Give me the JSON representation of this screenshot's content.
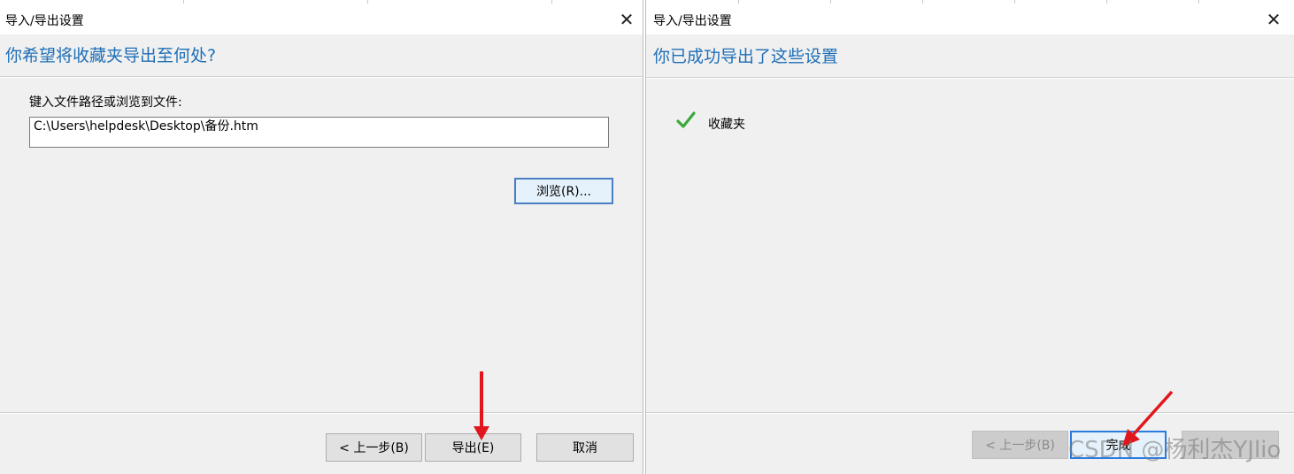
{
  "left_dialog": {
    "title": "导入/导出设置",
    "heading": "你希望将收藏夹导出至何处?",
    "path_label": "键入文件路径或浏览到文件:",
    "path_value": "C:\\Users\\helpdesk\\Desktop\\备份.htm",
    "browse_button": "浏览(R)...",
    "back_button": "< 上一步(B)",
    "export_button": "导出(E)",
    "cancel_button": "取消"
  },
  "right_dialog": {
    "title": "导入/导出设置",
    "heading": "你已成功导出了这些设置",
    "item_label": "收藏夹",
    "back_button": "< 上一步(B)",
    "finish_button": "完成"
  },
  "watermark": "CSDN @杨利杰YJlio",
  "colors": {
    "heading": "#1f6fb7",
    "annotation_arrow": "#e0161c",
    "check": "#3aa93a"
  }
}
